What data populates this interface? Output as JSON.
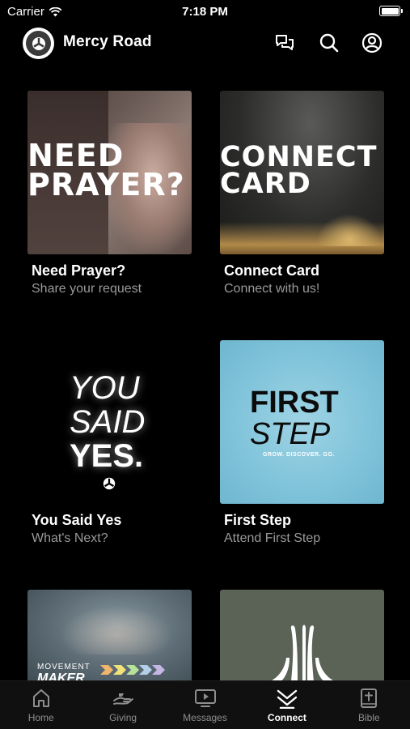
{
  "status_bar": {
    "carrier": "Carrier",
    "time": "7:18 PM"
  },
  "header": {
    "title": "Mercy Road",
    "icons": [
      "chat-icon",
      "search-icon",
      "profile-icon"
    ]
  },
  "cards": [
    {
      "title": "Need Prayer?",
      "subtitle": "Share your request",
      "art_text": [
        "NEED",
        "PRAYER?"
      ]
    },
    {
      "title": "Connect Card",
      "subtitle": "Connect with us!",
      "art_text": [
        "CONNECT",
        "CARD"
      ]
    },
    {
      "title": "You Said Yes",
      "subtitle": "What's Next?",
      "art_text": [
        "YOU",
        "SAID",
        "YES."
      ]
    },
    {
      "title": "First Step",
      "subtitle": "Attend First Step",
      "art_text": [
        "FIRST",
        "STEP",
        "GROW. DISCOVER. GO."
      ]
    },
    {
      "title": "",
      "subtitle": "",
      "art_text": [
        "MOVEMENT",
        "MAKER"
      ]
    },
    {
      "title": "",
      "subtitle": "",
      "art_text": []
    }
  ],
  "tabs": [
    {
      "label": "Home",
      "icon": "home-icon",
      "active": false
    },
    {
      "label": "Giving",
      "icon": "giving-icon",
      "active": false
    },
    {
      "label": "Messages",
      "icon": "messages-icon",
      "active": false
    },
    {
      "label": "Connect",
      "icon": "connect-icon",
      "active": true
    },
    {
      "label": "Bible",
      "icon": "bible-icon",
      "active": false
    }
  ],
  "colors": {
    "background": "#000000",
    "subtitle": "#9a9a9a",
    "first_step_bg": "#7fc3da",
    "tab_inactive": "#8e8e8e"
  }
}
